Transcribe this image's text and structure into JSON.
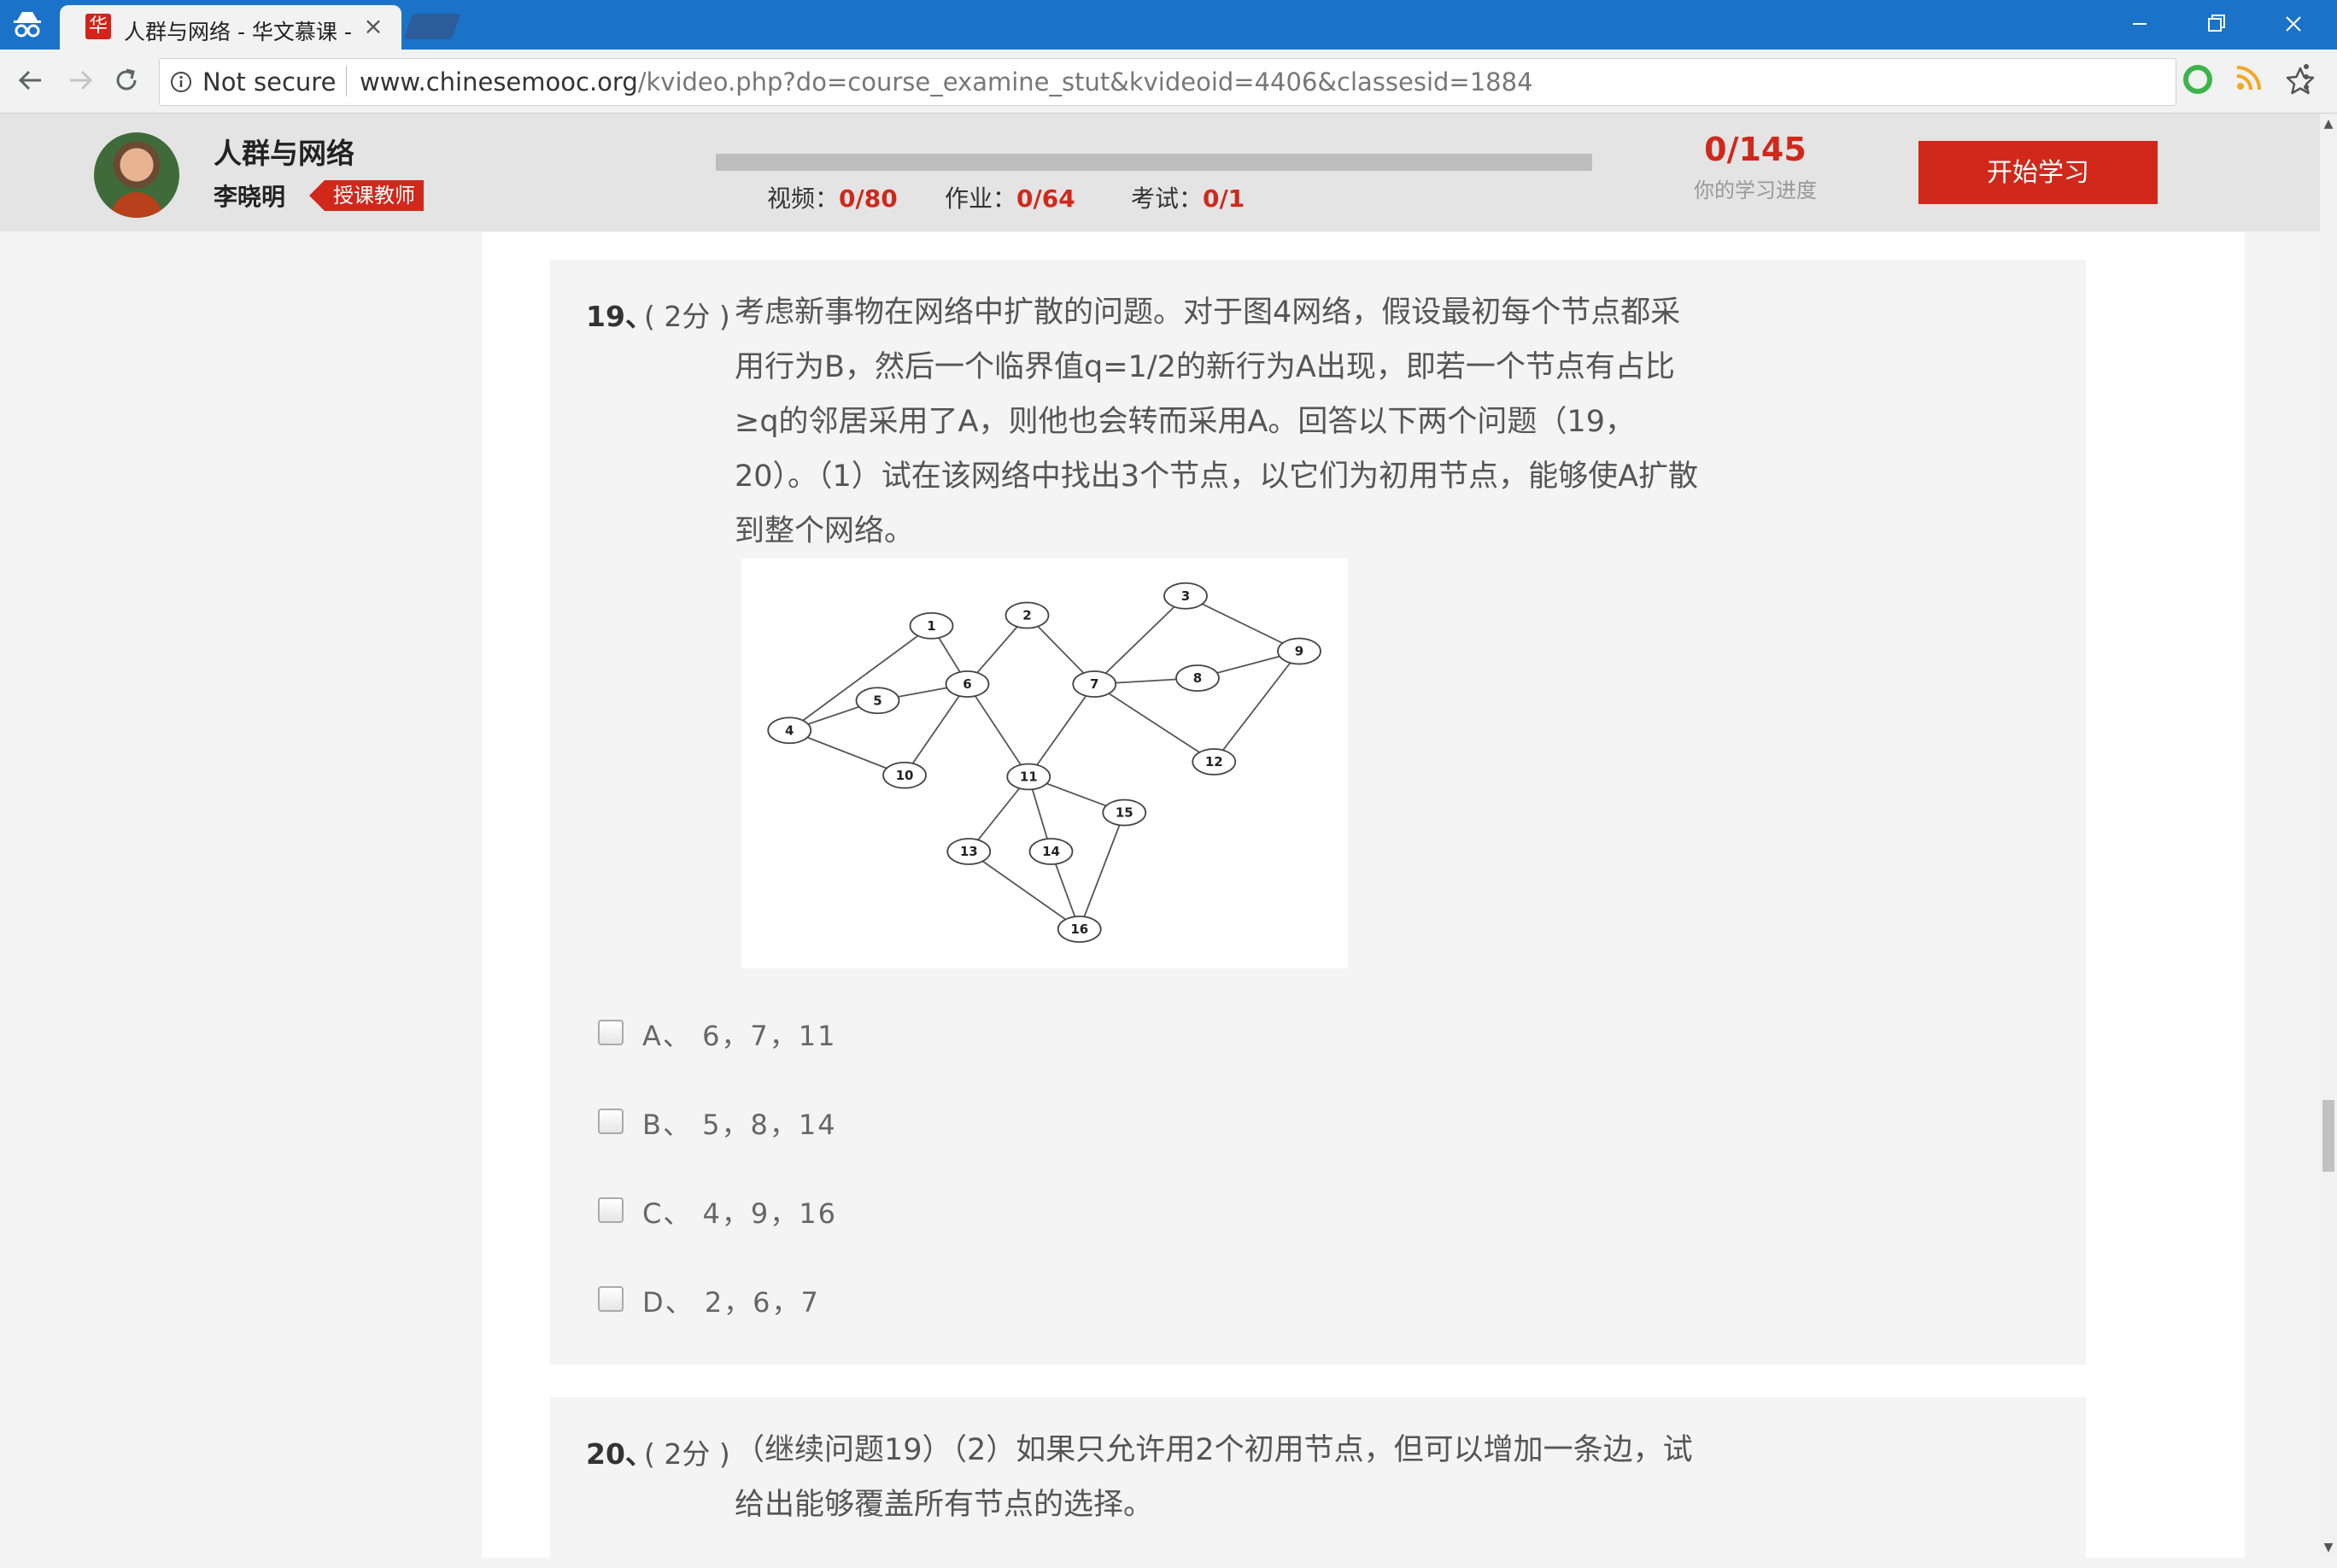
{
  "browser": {
    "tab_title": "人群与网络 - 华文慕课 -",
    "tab_favicon": "华",
    "close_glyph": "×",
    "security_label": "Not secure",
    "url_host": "www.chinesemooc.org",
    "url_path": "/kvideo.php?do=course_examine_stut&kvideoid=4406&classesid=1884",
    "icons": [
      "incognito-icon",
      "back-arrow-icon",
      "forward-arrow-icon",
      "reload-icon",
      "info-icon",
      "star-icon",
      "extension-icon",
      "rss-icon",
      "menu-icon"
    ]
  },
  "course": {
    "title": "人群与网络",
    "teacher": "李晓明",
    "teacher_badge": "授课教师",
    "stats": {
      "video_label": "视频：",
      "video_value": "0/80",
      "homework_label": "作业：",
      "homework_value": "0/64",
      "exam_label": "考试：",
      "exam_value": "0/1"
    },
    "progress_count": "0/145",
    "progress_caption": "你的学习进度",
    "start_button": "开始学习",
    "accent_color": "#d0281b"
  },
  "questions": [
    {
      "number": "19、",
      "score": "( 2分 )",
      "text": "考虑新事物在网络中扩散的问题。对于图4网络，假设最初每个节点都采用行为B，然后一个临界值q=1/2的新行为A出现，即若一个节点有占比≥q的邻居采用了A，则他也会转而采用A。回答以下两个问题（19，20）。（1）试在该网络中找出3个节点，以它们为初用节点，能够使A扩散到整个网络。",
      "figure": {
        "nodes": [
          "1",
          "2",
          "3",
          "4",
          "5",
          "6",
          "7",
          "8",
          "9",
          "10",
          "11",
          "12",
          "13",
          "14",
          "15",
          "16"
        ],
        "edges": [
          [
            "1",
            "4"
          ],
          [
            "1",
            "6"
          ],
          [
            "2",
            "6"
          ],
          [
            "2",
            "7"
          ],
          [
            "3",
            "7"
          ],
          [
            "3",
            "9"
          ],
          [
            "4",
            "5"
          ],
          [
            "4",
            "10"
          ],
          [
            "5",
            "6"
          ],
          [
            "6",
            "10"
          ],
          [
            "6",
            "11"
          ],
          [
            "7",
            "8"
          ],
          [
            "7",
            "11"
          ],
          [
            "7",
            "12"
          ],
          [
            "8",
            "9"
          ],
          [
            "9",
            "12"
          ],
          [
            "11",
            "13"
          ],
          [
            "11",
            "14"
          ],
          [
            "11",
            "15"
          ],
          [
            "13",
            "16"
          ],
          [
            "14",
            "16"
          ],
          [
            "15",
            "16"
          ]
        ]
      },
      "options": [
        {
          "label": "A、 6，7，11"
        },
        {
          "label": "B、 5，8，14"
        },
        {
          "label": "C、 4，9，16"
        },
        {
          "label": "D、 2，6，7"
        }
      ]
    },
    {
      "number": "20、",
      "score": "( 2分 )",
      "text": "（继续问题19）（2）如果只允许用2个初用节点，但可以增加一条边，试给出能够覆盖所有节点的选择。"
    }
  ]
}
